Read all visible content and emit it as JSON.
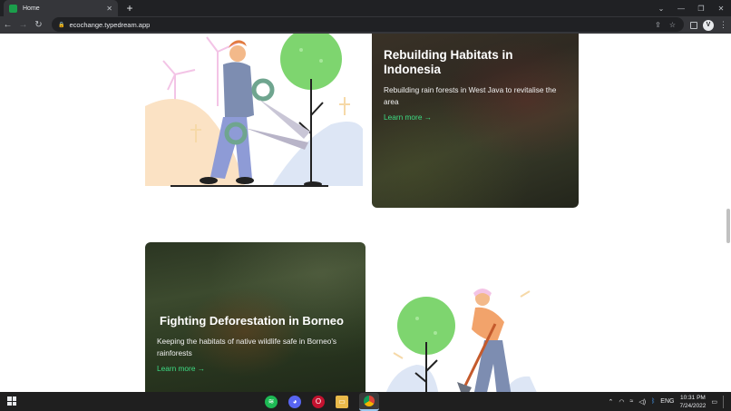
{
  "browser": {
    "tab_title": "Home",
    "tab_close": "✕",
    "new_tab": "+",
    "url": "ecochange.typedream.app",
    "profile_initial": "V",
    "window_controls": {
      "tab_search": "⌄",
      "minimize": "—",
      "restore": "❐",
      "close": "✕"
    },
    "icons": {
      "back": "back-arrow-icon",
      "forward": "forward-arrow-icon",
      "reload": "reload-icon",
      "lock": "lock-icon",
      "share": "share-icon",
      "star": "star-icon",
      "sidebar": "sidebar-icon",
      "menu": "kebab-menu-icon"
    }
  },
  "cards": [
    {
      "title": "Rebuilding Habitats in Indonesia",
      "description": "Rebuilding rain forests in West Java to revitalise the area",
      "link": "Learn more →"
    },
    {
      "title": "Fighting Deforestation in Borneo",
      "description": "Keeping the habitats of native wildlife safe in Borneo's rainforests",
      "link": "Learn more →"
    }
  ],
  "illustrations": {
    "top": "person-with-shears-illustration",
    "bottom": "person-with-shovel-illustration"
  },
  "taskbar": {
    "apps": [
      "spotify-icon",
      "discord-icon",
      "opera-icon",
      "file-explorer-icon",
      "chrome-icon"
    ],
    "language": "ENG",
    "time": "10:31 PM",
    "date": "7/24/2022"
  },
  "colors": {
    "accent": "#3ddc84",
    "tree": "#7ed56f",
    "chrome_bg": "#202124"
  }
}
